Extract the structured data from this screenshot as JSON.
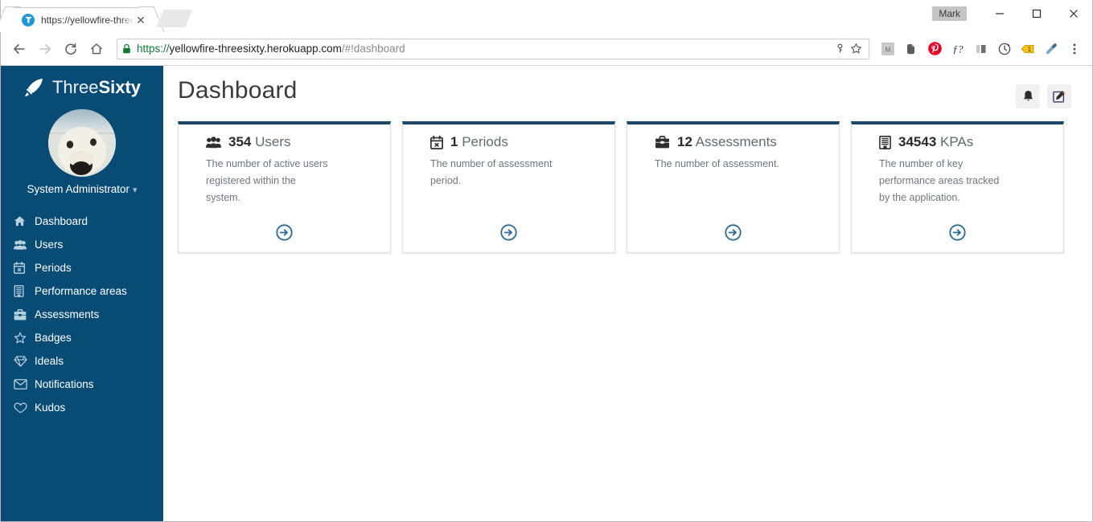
{
  "browser": {
    "tab": {
      "title": "https://yellowfire-threesi",
      "favicon_name": "site-favicon",
      "close_label": "✕"
    },
    "window": {
      "mark_label": "Mark",
      "minimize_name": "minimize-button",
      "maximize_name": "maximize-button",
      "close_name": "close-button"
    },
    "toolbar": {
      "back_name": "back-button",
      "forward_name": "forward-button",
      "reload_name": "reload-button",
      "home_name": "home-button",
      "url_scheme": "https://",
      "url_host": "yellowfire-threesixty.herokuapp.com",
      "url_path": "/#!dashboard",
      "url_full": "https://yellowfire-threesixty.herokuapp.com/#!dashboard",
      "extensions": [
        {
          "name": "mendeley-extension-icon",
          "glyph": "M"
        },
        {
          "name": "evernote-extension-icon",
          "glyph": ""
        },
        {
          "name": "pinterest-extension-icon",
          "glyph": ""
        },
        {
          "name": "fontface-ninja-extension-icon",
          "glyph": "ƒ?"
        },
        {
          "name": "split-view-extension-icon",
          "glyph": ""
        },
        {
          "name": "history-extension-icon",
          "glyph": ""
        },
        {
          "name": "tag-extension-icon",
          "glyph": "1"
        },
        {
          "name": "eyedropper-extension-icon",
          "glyph": ""
        },
        {
          "name": "chrome-menu-icon",
          "glyph": "⋮"
        }
      ]
    }
  },
  "sidebar": {
    "brand": {
      "light": "Three",
      "bold": "Sixty",
      "icon": "rocket-icon"
    },
    "user": {
      "name": "System Administrator",
      "caret": "▾",
      "avatar_name": "user-avatar"
    },
    "items": [
      {
        "label": "Dashboard",
        "icon": "home-icon",
        "active": true
      },
      {
        "label": "Users",
        "icon": "users-group-icon",
        "active": false
      },
      {
        "label": "Periods",
        "icon": "calendar-x-icon",
        "active": false
      },
      {
        "label": "Performance areas",
        "icon": "list-building-icon",
        "active": false
      },
      {
        "label": "Assessments",
        "icon": "briefcase-icon",
        "active": false
      },
      {
        "label": "Badges",
        "icon": "star-outline-icon",
        "active": false
      },
      {
        "label": "Ideals",
        "icon": "diamond-icon",
        "active": false
      },
      {
        "label": "Notifications",
        "icon": "envelope-icon",
        "active": false
      },
      {
        "label": "Kudos",
        "icon": "heart-outline-icon",
        "active": false
      }
    ]
  },
  "page": {
    "title": "Dashboard",
    "actions": [
      {
        "name": "notifications-bell-button",
        "icon": "bell-icon"
      },
      {
        "name": "edit-dashboard-button",
        "icon": "pencil-square-icon"
      }
    ]
  },
  "cards": [
    {
      "number": "354",
      "label": "Users",
      "description": "The number of active users registered within the system.",
      "icon": "users-group-icon",
      "arrow": "circle-arrow-right-icon"
    },
    {
      "number": "1",
      "label": "Periods",
      "description": "The number of assessment period.",
      "icon": "calendar-x-icon",
      "arrow": "circle-arrow-right-icon"
    },
    {
      "number": "12",
      "label": "Assessments",
      "description": "The number of assessment.",
      "icon": "briefcase-icon",
      "arrow": "circle-arrow-right-icon"
    },
    {
      "number": "34543",
      "label": "KPAs",
      "description": "The number of key performance areas tracked by the application.",
      "icon": "building-icon",
      "arrow": "circle-arrow-right-icon"
    }
  ],
  "colors": {
    "sidebar_bg": "#084c76",
    "card_top_border": "#17486b",
    "arrow_blue": "#2b6a93",
    "lock_green": "#0f7a33",
    "content_bg": "#ffffff"
  }
}
